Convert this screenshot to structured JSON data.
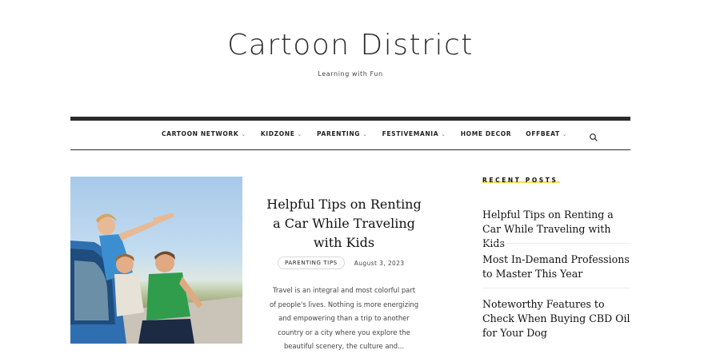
{
  "site": {
    "title": "Cartoon District",
    "tagline": "Learning with Fun"
  },
  "nav": {
    "items": [
      {
        "label": "CARTOON NETWORK",
        "has_dropdown": true
      },
      {
        "label": "KIDZONE",
        "has_dropdown": true
      },
      {
        "label": "PARENTING",
        "has_dropdown": true
      },
      {
        "label": "FESTIVEMANIA",
        "has_dropdown": true
      },
      {
        "label": "HOME DECOR",
        "has_dropdown": false
      },
      {
        "label": "OFFBEAT",
        "has_dropdown": true
      }
    ],
    "chevron": "⌄",
    "search_icon": "search-icon"
  },
  "featured": {
    "title": "Helpful Tips on Renting a Car While Traveling with Kids",
    "category": "PARENTING TIPS",
    "date": "August 3, 2023",
    "excerpt": "Travel is an integral and most colorful part of people's lives. Nothing is more energizing and empowering than a trip to another country or a city where you explore the beautiful scenery, the culture and..."
  },
  "sidebar": {
    "heading": "RECENT POSTS",
    "heading_highlight": "#f5e15c",
    "posts": [
      {
        "title": "Helpful Tips on Renting a Car While Traveling with Kids"
      },
      {
        "title": "Most In-Demand Professions to Master This Year"
      },
      {
        "title": "Noteworthy Features to Check When Buying CBD Oil for Your Dog"
      }
    ]
  },
  "colors": {
    "nav_rule": "#2a2a2a",
    "text": "#111111"
  }
}
